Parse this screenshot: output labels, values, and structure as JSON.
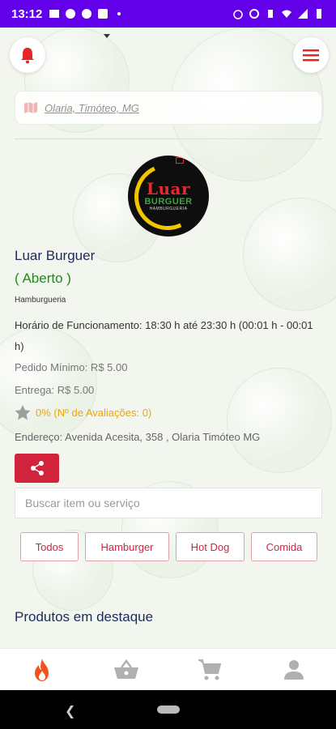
{
  "status_bar": {
    "time": "13:12"
  },
  "location": {
    "text": "Olaria, Timóteo, MG"
  },
  "store": {
    "logo_line1": "Luar",
    "logo_line2": "BURGUER",
    "logo_line3": "HAMBURGUERIA",
    "name": "Luar Burguer",
    "status": "( Aberto )",
    "category": "Hamburgueria",
    "hours": "Horário de Funcionamento: 18:30 h até 23:30 h (00:01 h - 00:01 h)",
    "min_order": "Pedido Mínimo: R$ 5.00",
    "delivery": "Entrega: R$ 5.00",
    "rating": "0% (Nº de Avaliações: 0)",
    "address": "Endereço: Avenida Acesita, 358 , Olaria Timóteo MG"
  },
  "search": {
    "placeholder": "Buscar item ou serviço"
  },
  "categories": [
    "Todos",
    "Hamburger",
    "Hot Dog",
    "Comida"
  ],
  "featured_title": "Produtos em destaque",
  "colors": {
    "accent": "#d2233d",
    "open_green": "#1e8b1e",
    "status_bar": "#6200ea",
    "active_nav": "#f4511e"
  },
  "icons": {
    "bell": "bell-icon",
    "menu": "menu-icon",
    "map": "map-icon",
    "star": "star-icon",
    "share": "share-icon",
    "nav": [
      "fire-icon",
      "basket-icon",
      "cart-icon",
      "user-icon"
    ]
  }
}
